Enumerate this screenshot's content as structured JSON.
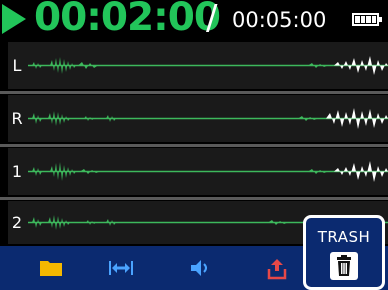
{
  "header": {
    "current_time": "00:02:00",
    "separator": "/",
    "total_time": "00:05:00"
  },
  "tracks": [
    {
      "label": "L"
    },
    {
      "label": "R"
    },
    {
      "label": "1"
    },
    {
      "label": "2"
    }
  ],
  "toolbar": {
    "trash_label": "TRASH"
  },
  "icons": [
    "play-icon",
    "battery-icon",
    "folder-icon",
    "trim-icon",
    "speaker-icon",
    "export-icon",
    "trash-icon"
  ],
  "colors": {
    "accent": "#22c55a",
    "waveform_green": "#3db85c",
    "toolbar_blue": "#0b2a70",
    "track_bg": "#1a1a1a"
  }
}
